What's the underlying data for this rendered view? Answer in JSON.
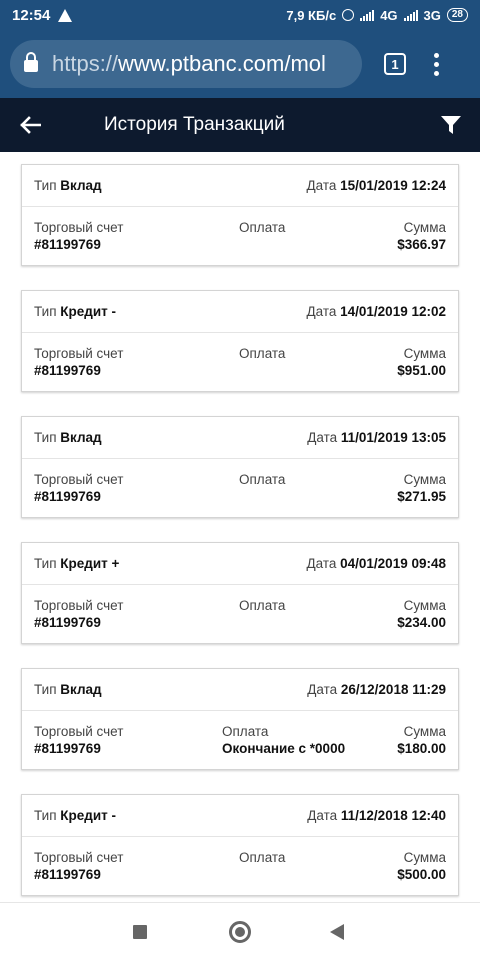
{
  "status_bar": {
    "time": "12:54",
    "speed": "7,9 КБ/с",
    "net1": "4G",
    "net2": "3G",
    "battery": "28"
  },
  "browser": {
    "url_proto": "https://",
    "url_host": "www.ptbanc.com/mol",
    "tab_count": "1"
  },
  "header": {
    "title": "История Транзакций"
  },
  "labels": {
    "type": "Тип",
    "date": "Дата",
    "account": "Торговый счет",
    "payment": "Оплата",
    "amount": "Сумма"
  },
  "transactions": [
    {
      "type": "Вклад",
      "date": "15/01/2019 12:24",
      "account": "#81199769",
      "payment": "",
      "amount": "$366.97"
    },
    {
      "type": "Кредит -",
      "date": "14/01/2019 12:02",
      "account": "#81199769",
      "payment": "",
      "amount": "$951.00"
    },
    {
      "type": "Вклад",
      "date": "11/01/2019 13:05",
      "account": "#81199769",
      "payment": "",
      "amount": "$271.95"
    },
    {
      "type": "Кредит +",
      "date": "04/01/2019 09:48",
      "account": "#81199769",
      "payment": "",
      "amount": "$234.00"
    },
    {
      "type": "Вклад",
      "date": "26/12/2018 11:29",
      "account": "#81199769",
      "payment": "Окончание с *0000",
      "amount": "$180.00"
    },
    {
      "type": "Кредит -",
      "date": "11/12/2018 12:40",
      "account": "#81199769",
      "payment": "",
      "amount": "$500.00"
    }
  ],
  "colors": {
    "browser_bar": "#1f4f7d",
    "app_header": "#0d1a2e"
  }
}
